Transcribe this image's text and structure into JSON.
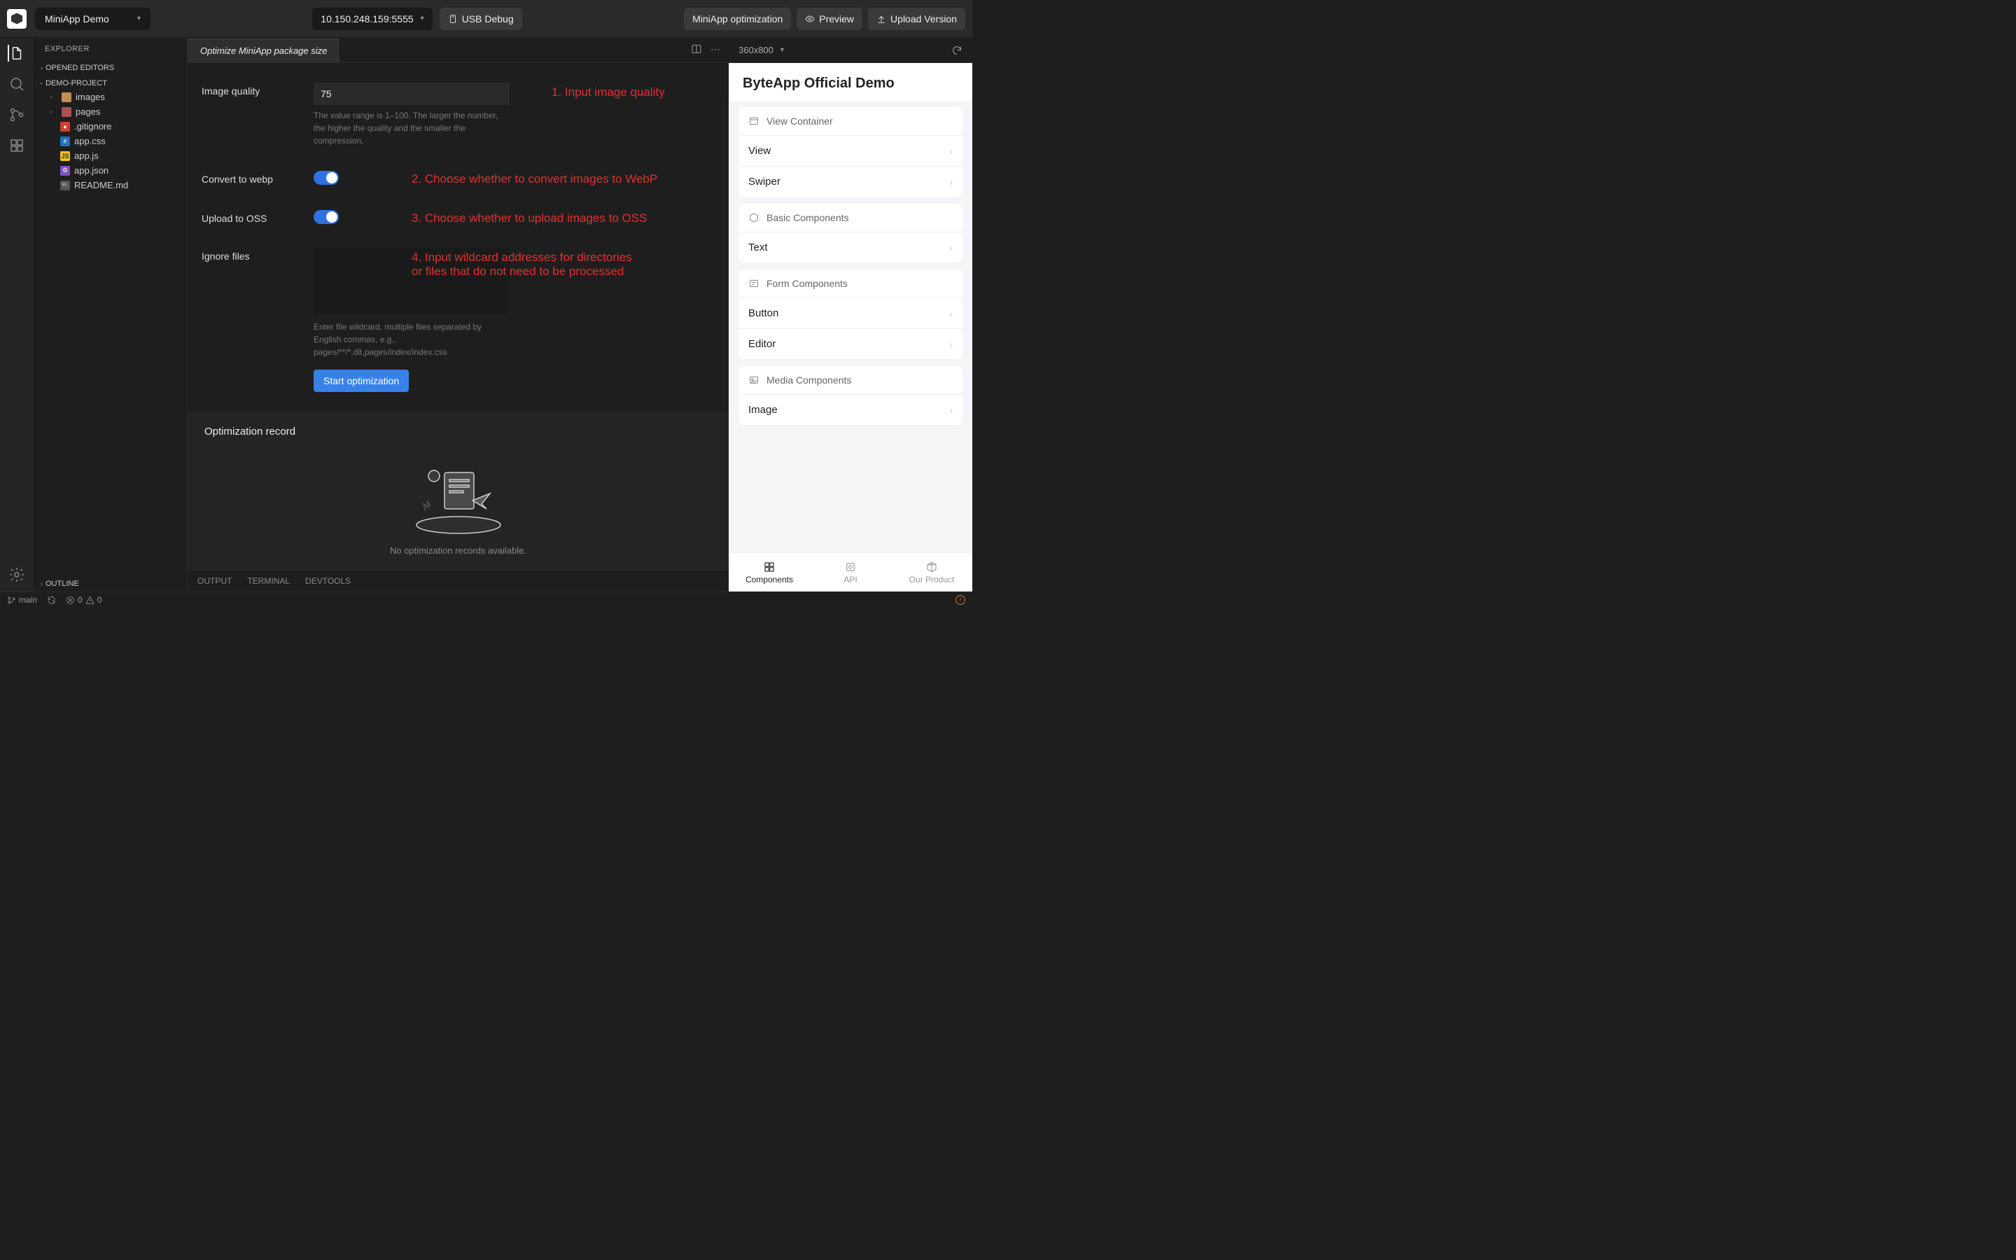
{
  "topbar": {
    "project_name": "MiniApp Demo",
    "device_ip": "10.150.248.159:5555",
    "usb_debug": "USB Debug",
    "optimize_btn": "MiniApp optimization",
    "preview_btn": "Preview",
    "upload_btn": "Upload Version"
  },
  "sidebar": {
    "title": "EXPLORER",
    "opened_editors": "OPENED EDITORS",
    "project_root": "DEMO-PROJECT",
    "folders": [
      "images",
      "pages"
    ],
    "files": [
      {
        "name": ".gitignore",
        "icon": "git"
      },
      {
        "name": "app.css",
        "icon": "css"
      },
      {
        "name": "app.js",
        "icon": "js"
      },
      {
        "name": "app.json",
        "icon": "json"
      },
      {
        "name": "README.md",
        "icon": "md"
      }
    ],
    "outline": "OUTLINE"
  },
  "editor": {
    "tab_title": "Optimize MiniApp package size",
    "form": {
      "quality_label": "Image quality",
      "quality_value": "75",
      "quality_hint": "The value range is 1–100. The larger the number, the higher the quality and the smaller the compression.",
      "webp_label": "Convert to webp",
      "oss_label": "Upload to OSS",
      "ignore_label": "Ignore files",
      "ignore_hint": "Enter file wildcard, multiple files separated by English commas, e.g., pages/**/*.dlt,pages/index/index.css",
      "start_btn": "Start optimization"
    },
    "annotations": {
      "a1": "1. Input image quality",
      "a2": "2. Choose whether to convert images to WebP",
      "a3": "3. Choose whether to upload images to OSS",
      "a4_l1": "4. Input wildcard addresses for directories",
      "a4_l2": "or files that do not need to be processed"
    },
    "record_title": "Optimization record",
    "empty_text": "No optimization records available.",
    "bottom_tabs": [
      "OUTPUT",
      "TERMINAL",
      "DEVTOOLS"
    ]
  },
  "preview": {
    "resolution": "360x800",
    "app_title": "ByteApp Official Demo",
    "groups": [
      {
        "header": "View Container",
        "items": [
          "View",
          "Swiper"
        ]
      },
      {
        "header": "Basic Components",
        "items": [
          "Text"
        ]
      },
      {
        "header": "Form Components",
        "items": [
          "Button",
          "Editor"
        ]
      },
      {
        "header": "Media Components",
        "items": [
          "Image"
        ]
      }
    ],
    "tabs": [
      "Components",
      "API",
      "Our Product"
    ]
  },
  "statusbar": {
    "branch": "main",
    "errors": "0",
    "warnings": "0"
  }
}
